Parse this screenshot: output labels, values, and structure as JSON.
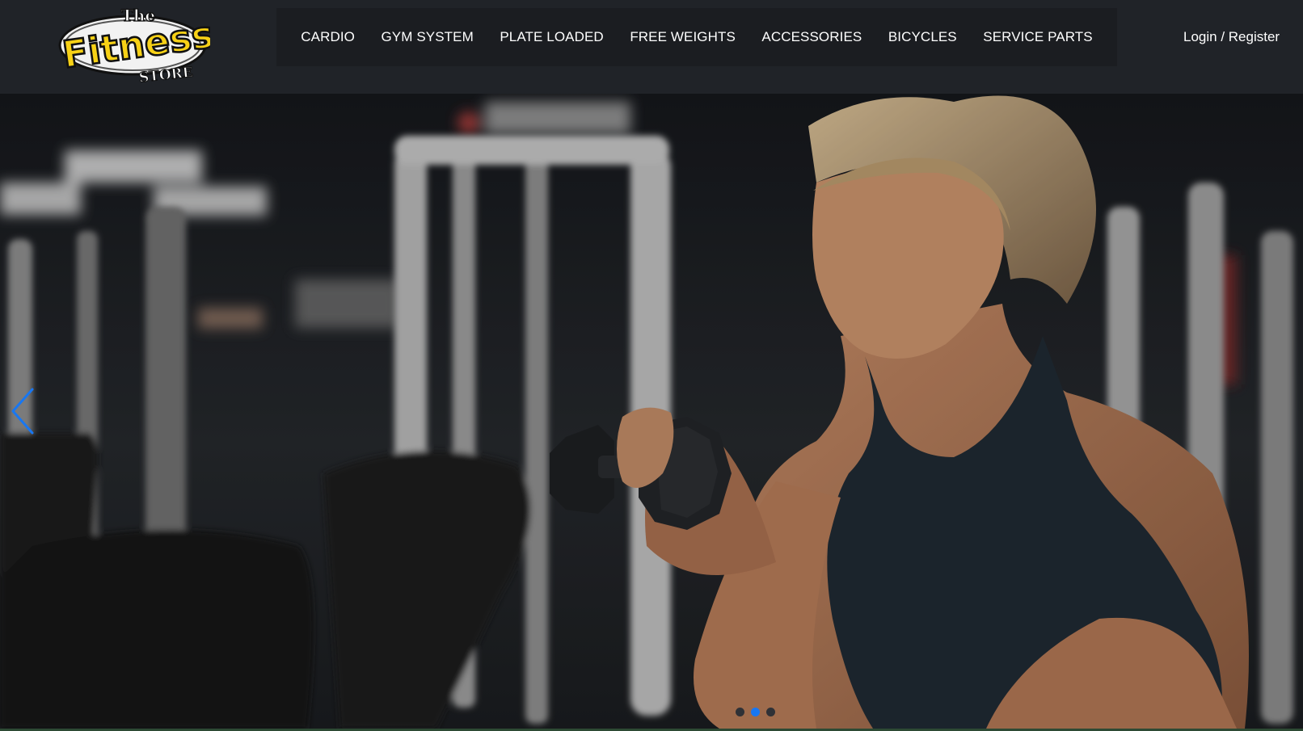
{
  "brand": {
    "logo_line1": "The",
    "logo_line2": "Fitness",
    "logo_line3": "STORE"
  },
  "nav": {
    "items": [
      {
        "label": "CARDIO"
      },
      {
        "label": "GYM SYSTEM"
      },
      {
        "label": "PLATE LOADED"
      },
      {
        "label": "FREE WEIGHTS"
      },
      {
        "label": "ACCESSORIES"
      },
      {
        "label": "BICYCLES"
      },
      {
        "label": "SERVICE PARTS"
      }
    ]
  },
  "auth": {
    "label": "Login / Register"
  },
  "hero": {
    "prev_icon": "chevron-left-icon",
    "slide_count": 3,
    "active_slide": 2
  },
  "colors": {
    "header_bg": "#202328",
    "nav_bg": "#1b1d21",
    "accent": "#1877f2",
    "logo_yellow": "#f7d116"
  }
}
